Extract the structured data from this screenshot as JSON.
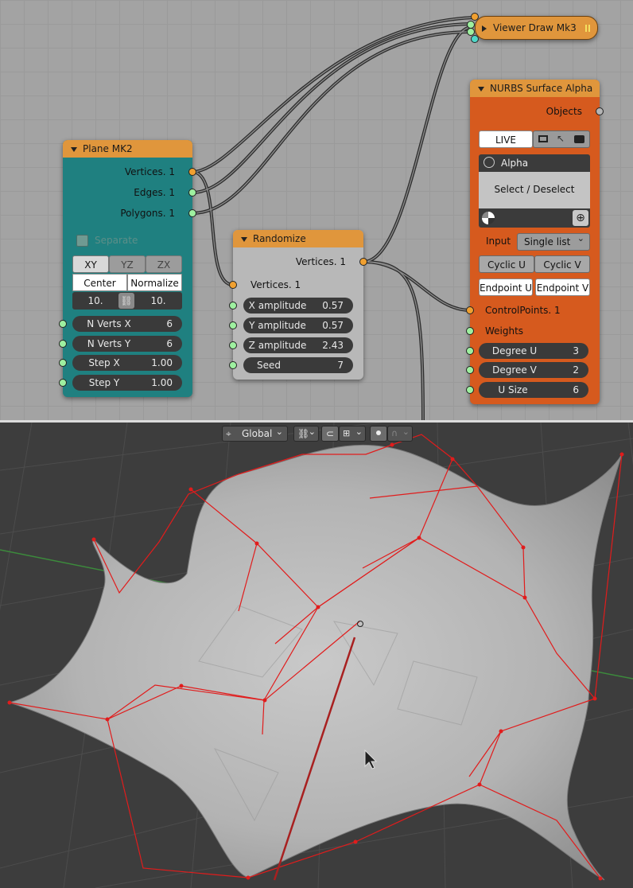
{
  "nodes": {
    "viewer_draw": {
      "title": "Viewer Draw Mk3"
    },
    "plane": {
      "title": "Plane MK2",
      "outputs": [
        "Vertices. 1",
        "Edges. 1",
        "Polygons. 1"
      ],
      "separate_label": "Separate",
      "axis_tabs": [
        "XY",
        "YZ",
        "ZX"
      ],
      "center_label": "Center",
      "normalize_label": "Normalize",
      "size_left": "10.",
      "size_right": "10.",
      "fields": [
        {
          "label": "N Verts X",
          "value": "6"
        },
        {
          "label": "N Verts Y",
          "value": "6"
        },
        {
          "label": "Step X",
          "value": "1.00"
        },
        {
          "label": "Step Y",
          "value": "1.00"
        }
      ]
    },
    "randomize": {
      "title": "Randomize",
      "output": "Vertices. 1",
      "input": "Vertices. 1",
      "fields": [
        {
          "label": "X amplitude",
          "value": "0.57"
        },
        {
          "label": "Y amplitude",
          "value": "0.57"
        },
        {
          "label": "Z amplitude",
          "value": "2.43"
        },
        {
          "label": "Seed",
          "value": "7"
        }
      ]
    },
    "nurbs": {
      "title": "NURBS Surface Alpha",
      "objects_label": "Objects",
      "live_label": "LIVE",
      "alpha_label": "Alpha",
      "select_label": "Select / Deselect",
      "input_label": "Input",
      "input_value": "Single list",
      "cyclic_u": "Cyclic U",
      "cyclic_v": "Cyclic V",
      "endpoint_u": "Endpoint U",
      "endpoint_v": "Endpoint V",
      "control_points": "ControlPoints. 1",
      "weights": "Weights",
      "fields": [
        {
          "label": "Degree U",
          "value": "3"
        },
        {
          "label": "Degree V",
          "value": "2"
        },
        {
          "label": "U Size",
          "value": "6"
        }
      ]
    }
  },
  "viewport_toolbar": {
    "orientation": "Global"
  },
  "colors": {
    "node_header": "#e0963c",
    "plane_body": "#1f8080",
    "nurbs_body": "#d65a1e",
    "control_lines": "#e11c1c"
  }
}
